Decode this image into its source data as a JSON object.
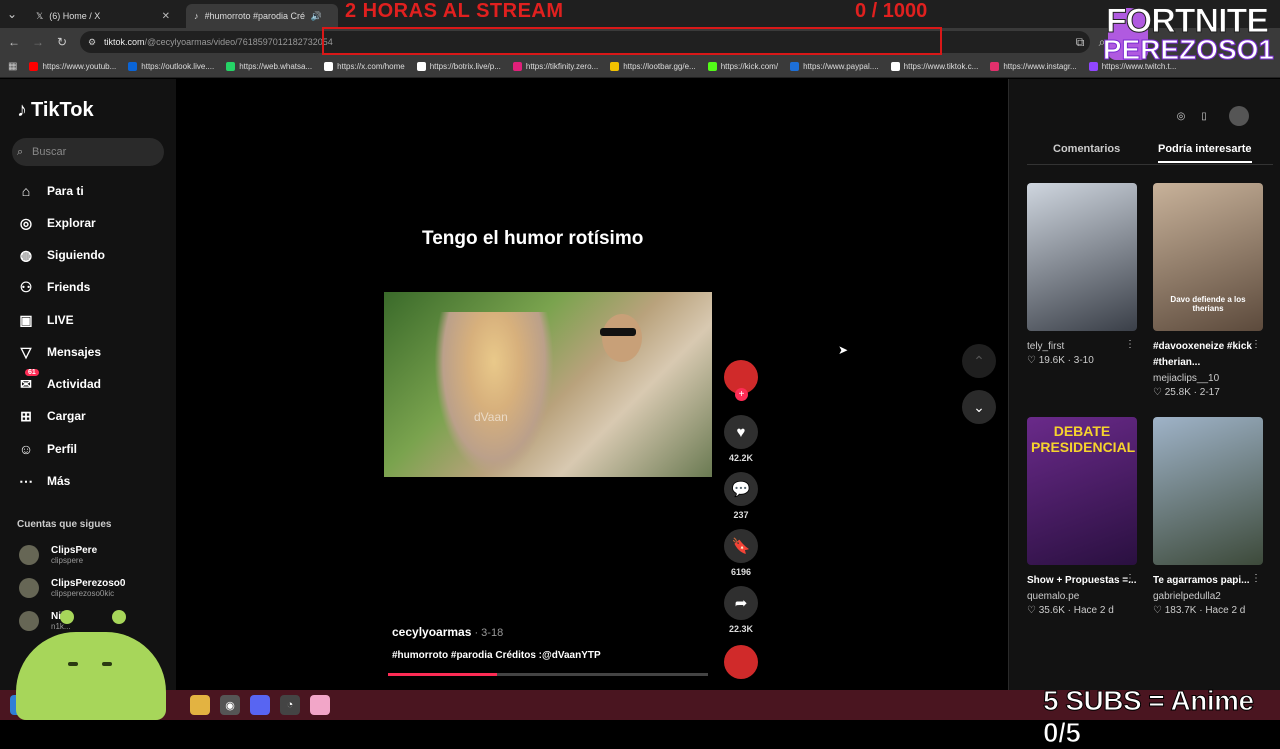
{
  "browser": {
    "tabs": [
      {
        "title": "(6) Home / X"
      },
      {
        "title": "#humorroto #parodia Créd"
      }
    ],
    "url_host": "tiktok.com",
    "url_path": "/@cecylyoarmas/video/7618597012182732054",
    "bookmarks": [
      {
        "label": "https://www.youtub...",
        "color": "#ff0000"
      },
      {
        "label": "https://outlook.live....",
        "color": "#0a64d6"
      },
      {
        "label": "https://web.whatsa...",
        "color": "#25d366"
      },
      {
        "label": "https://x.com/home",
        "color": "#ffffff"
      },
      {
        "label": "https://botrix.live/p...",
        "color": "#ffffff"
      },
      {
        "label": "https://tikfinity.zero...",
        "color": "#e0207a"
      },
      {
        "label": "https://lootbar.gg/e...",
        "color": "#f2c200"
      },
      {
        "label": "https://kick.com/",
        "color": "#53fc18"
      },
      {
        "label": "https://www.paypal....",
        "color": "#1d6fd8"
      },
      {
        "label": "https://www.tiktok.c...",
        "color": "#ffffff"
      },
      {
        "label": "https://www.instagr...",
        "color": "#e1306c"
      },
      {
        "label": "https://www.twitch.t...",
        "color": "#9146ff"
      }
    ]
  },
  "overlay": {
    "stream_title": "2 HORAS AL STREAM",
    "stream_count": "0  / 1000",
    "brand_line1": "FORTNITE",
    "brand_line2": "PEREZOSO1",
    "subs_goal": "5 SUBS = Anime 0/5"
  },
  "sidebar": {
    "logo": "TikTok",
    "search_placeholder": "Buscar",
    "nav": [
      {
        "label": "Para ti",
        "icon": "compass-icon"
      },
      {
        "label": "Explorar",
        "icon": "explore-icon"
      },
      {
        "label": "Siguiendo",
        "icon": "following-icon"
      },
      {
        "label": "Friends",
        "icon": "friends-icon"
      },
      {
        "label": "LIVE",
        "icon": "live-icon"
      },
      {
        "label": "Mensajes",
        "icon": "messages-icon"
      },
      {
        "label": "Actividad",
        "icon": "activity-icon",
        "badge": "61"
      },
      {
        "label": "Cargar",
        "icon": "upload-icon"
      },
      {
        "label": "Perfil",
        "icon": "profile-icon"
      },
      {
        "label": "Más",
        "icon": "more-icon"
      }
    ],
    "following_title": "Cuentas que sigues",
    "accounts": [
      {
        "name": "ClipsPere",
        "handle": "clipspere"
      },
      {
        "name": "ClipsPerezoso0",
        "handle": "clipsperezoso0kic"
      },
      {
        "name": "Nilo",
        "handle": "n1k..."
      }
    ]
  },
  "video": {
    "caption_top": "Tengo el humor rotísimo",
    "watermark": "dVaan",
    "author": "cecylyoarmas",
    "date": " · 3-18",
    "description": "#humorroto #parodia  Créditos :@dVaanYTP",
    "progress": 0.34,
    "likes": "42.2K",
    "comments": "237",
    "saves": "6196",
    "shares": "22.3K"
  },
  "right_panel": {
    "tab_comments": "Comentarios",
    "tab_suggested": "Podría interesarte",
    "cards": [
      {
        "title": "",
        "user": "tely_first",
        "stats": "♡ 19.6K · 3-10",
        "colors": [
          "#cfd6df",
          "#3a3f48"
        ]
      },
      {
        "title": "#davooxeneize #kick #therian...",
        "user": "mejiaclips__10",
        "stats": "♡ 25.8K · 2-17",
        "colors": [
          "#c8b29a",
          "#5c4a3c"
        ],
        "overlay": "Davo defiende a los therians"
      },
      {
        "title": "Show + Propuestas =...",
        "user": "quemalo.pe",
        "stats": "♡ 35.6K · Hace 2 d",
        "colors": [
          "#6a2a8a",
          "#2a1040"
        ],
        "overlay": "DEBATE PRESIDENCIAL"
      },
      {
        "title": "Te agarramos papi...",
        "user": "gabrielpedulla2",
        "stats": "♡ 183.7K · Hace 2 d",
        "colors": [
          "#9fb3c8",
          "#3d4a3a"
        ]
      }
    ]
  }
}
